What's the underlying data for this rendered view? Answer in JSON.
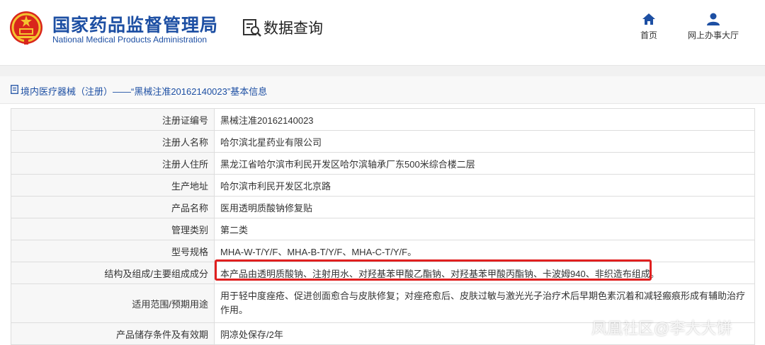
{
  "header": {
    "org_name_cn": "国家药品监督管理局",
    "org_name_en": "National Medical Products Administration",
    "emblem_icon": "national-emblem-icon",
    "data_query_label": "数据查询",
    "data_query_icon": "document-search-icon",
    "nav": [
      {
        "label": "首页",
        "icon": "home-icon"
      },
      {
        "label": "网上办事大厅",
        "icon": "user-icon"
      }
    ]
  },
  "record": {
    "title": "境内医疗器械（注册）——“黑械注准20162140023”基本信息",
    "title_icon": "document-icon",
    "rows": [
      {
        "label": "注册证编号",
        "value": "黑械注准20162140023"
      },
      {
        "label": "注册人名称",
        "value": "哈尔滨北星药业有限公司"
      },
      {
        "label": "注册人住所",
        "value": "黑龙江省哈尔滨市利民开发区哈尔滨轴承厂东500米综合楼二层"
      },
      {
        "label": "生产地址",
        "value": "哈尔滨市利民开发区北京路"
      },
      {
        "label": "产品名称",
        "value": "医用透明质酸钠修复贴"
      },
      {
        "label": "管理类别",
        "value": "第二类"
      },
      {
        "label": "型号规格",
        "value": "MHA-W-T/Y/F、MHA-B-T/Y/F、MHA-C-T/Y/F。"
      },
      {
        "label": "结构及组成/主要组成成分",
        "value": "本产品由透明质酸钠、注射用水、对羟基苯甲酸乙酯钠、对羟基苯甲酸丙酯钠、卡波姆940、非织造布组成。"
      },
      {
        "label": "适用范围/预期用途",
        "value": "用于轻中度痤疮、促进创面愈合与皮肤修复；对痤疮愈后、皮肤过敏与激光光子治疗术后早期色素沉着和减轻瘢痕形成有辅助治疗作用。"
      },
      {
        "label": "产品储存条件及有效期",
        "value": "阴凉处保存/2年"
      }
    ]
  },
  "watermark": "凤凰社区@李大大饼",
  "colors": {
    "brand_blue": "#1d4fa3",
    "highlight_red": "#e02020"
  }
}
